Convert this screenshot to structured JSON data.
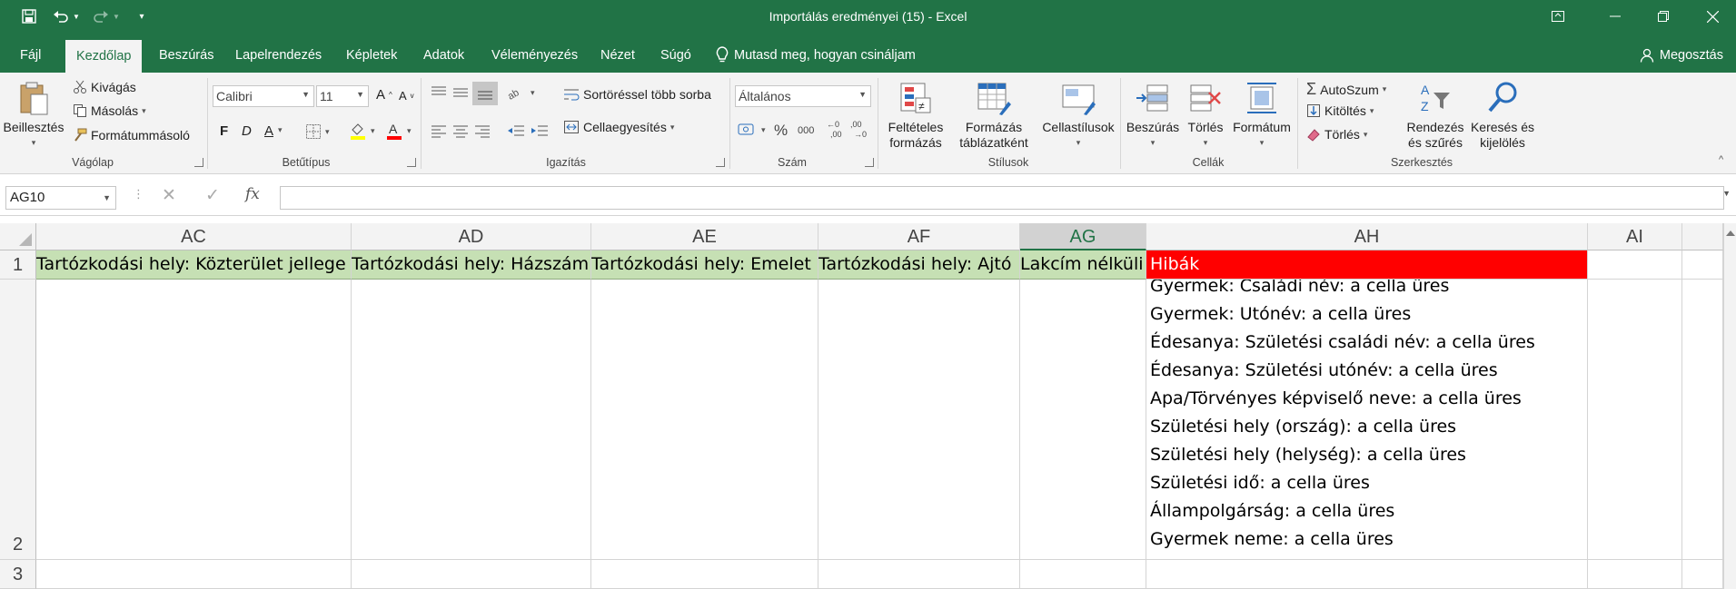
{
  "window": {
    "title": "Importálás eredményei (15)  -  Excel"
  },
  "tabs": [
    "Fájl",
    "Kezdőlap",
    "Beszúrás",
    "Lapelrendezés",
    "Képletek",
    "Adatok",
    "Véleményezés",
    "Nézet",
    "Súgó"
  ],
  "tell_me": "Mutasd meg, hogyan csináljam",
  "share": "Megosztás",
  "ribbon": {
    "clipboard": {
      "label": "Vágólap",
      "paste": "Beillesztés",
      "cut": "Kivágás",
      "copy": "Másolás",
      "format_painter": "Formátummásoló"
    },
    "font": {
      "label": "Betűtípus",
      "name": "Calibri",
      "size": "11",
      "bold": "F",
      "italic": "D",
      "underline": "A"
    },
    "alignment": {
      "label": "Igazítás",
      "wrap": "Sortöréssel több sorba",
      "merge": "Cellaegyesítés"
    },
    "number": {
      "label": "Szám",
      "format": "Általános",
      "percent": "%",
      "thousands": "000"
    },
    "styles": {
      "label": "Stílusok",
      "conditional_1": "Feltételes",
      "conditional_2": "formázás",
      "table_1": "Formázás",
      "table_2": "táblázatként",
      "cell_styles": "Cellastílusok"
    },
    "cells": {
      "label": "Cellák",
      "insert": "Beszúrás",
      "delete": "Törlés",
      "format": "Formátum"
    },
    "editing": {
      "label": "Szerkesztés",
      "autosum": "AutoSzum",
      "fill": "Kitöltés",
      "clear": "Törlés",
      "sort_1": "Rendezés",
      "sort_2": "és szűrés",
      "find_1": "Keresés és",
      "find_2": "kijelölés"
    }
  },
  "formula_bar": {
    "name_box": "AG10",
    "formula": ""
  },
  "columns": [
    "AC",
    "AD",
    "AE",
    "AF",
    "AG",
    "AH",
    "AI"
  ],
  "selected_column": "AG",
  "rows": [
    "1",
    "2",
    "3"
  ],
  "row1": {
    "AC": "Tartózkodási hely: Közterület jellege",
    "AD": "Tartózkodási hely: Házszám",
    "AE": "Tartózkodási hely: Emelet",
    "AF": "Tartózkodási hely: Ajtó",
    "AG": "Lakcím nélküli",
    "AH": "Hibák"
  },
  "row2_errors": [
    "Gyermek: Családi név: a cella üres",
    "Gyermek: Utónév: a cella üres",
    "Édesanya: Születési családi név: a cella üres",
    "Édesanya: Születési utónév: a cella üres",
    "Apa/Törvényes képviselő neve: a cella üres",
    "Születési hely (ország): a cella üres",
    "Születési hely (helység): a cella üres",
    "Születési idő: a cella üres",
    "Állampolgárság: a cella üres",
    "Gyermek neme: a cella üres"
  ],
  "colors": {
    "excel_green": "#217346",
    "header_fill": "#c6e0b4",
    "error_fill": "#ff0000"
  }
}
